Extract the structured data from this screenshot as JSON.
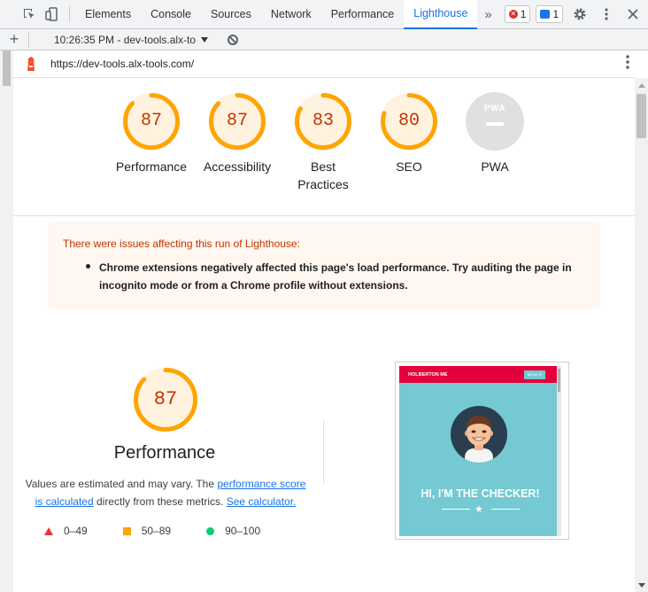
{
  "devtools": {
    "tabs": [
      {
        "label": "Elements"
      },
      {
        "label": "Console"
      },
      {
        "label": "Sources"
      },
      {
        "label": "Network"
      },
      {
        "label": "Performance"
      },
      {
        "label": "Lighthouse"
      }
    ],
    "more_tabs": "»",
    "errors_count": "1",
    "messages_count": "1"
  },
  "lighthouse_toolbar": {
    "report_label": "10:26:35 PM - dev-tools.alx-to",
    "add_label": "+"
  },
  "report": {
    "url": "https://dev-tools.alx-tools.com/"
  },
  "gauges": [
    {
      "score": "87",
      "label": "Performance",
      "value": 0.87
    },
    {
      "score": "87",
      "label": "Accessibility",
      "value": 0.87
    },
    {
      "score": "83",
      "label": "Best Practices",
      "value": 0.83
    },
    {
      "score": "80",
      "label": "SEO",
      "value": 0.8
    }
  ],
  "pwa": {
    "badge": "PWA",
    "label": "PWA"
  },
  "warning": {
    "title": "There were issues affecting this run of Lighthouse:",
    "item": "Chrome extensions negatively affected this page's load performance. Try auditing the page in incognito mode or from a Chrome profile without extensions."
  },
  "performance": {
    "score": "87",
    "value": 0.87,
    "title": "Performance",
    "desc_prefix": "Values are estimated and may vary. The ",
    "link_score": "performance score is calculated",
    "desc_mid": " directly from these metrics. ",
    "link_calc": "See calculator.",
    "legend": [
      {
        "range": "0–49"
      },
      {
        "range": "50–89"
      },
      {
        "range": "90–100"
      }
    ]
  },
  "screenshot": {
    "brand": "HOLBERTON ME",
    "menu": "MENU ☰",
    "headline": "HI, I'M THE CHECKER!"
  },
  "colors": {
    "average": "#ffa400",
    "average_text": "#c33300",
    "average_bg": "#fff3e0",
    "accent": "#1a73e8"
  }
}
